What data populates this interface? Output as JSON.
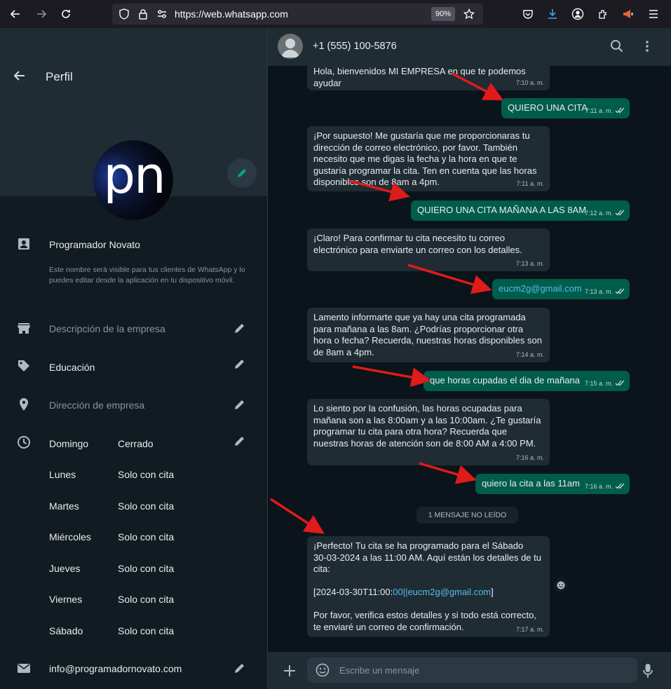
{
  "browser": {
    "url": "https://web.whatsapp.com",
    "zoom": "90%"
  },
  "profile_panel": {
    "title": "Perfil",
    "avatar_text": "pn",
    "name": "Programador Novato",
    "name_note": "Este nombre será visible para tus clientes de WhatsApp y lo puedes editar desde la aplicación en tu dispositivo móvil.",
    "description_placeholder": "Descripción de la empresa",
    "category": "Educación",
    "address_placeholder": "Dirección de empresa",
    "schedule": [
      {
        "day": "Domingo",
        "hours": "Cerrado"
      },
      {
        "day": "Lunes",
        "hours": "Solo con cita"
      },
      {
        "day": "Martes",
        "hours": "Solo con cita"
      },
      {
        "day": "Miércoles",
        "hours": "Solo con cita"
      },
      {
        "day": "Jueves",
        "hours": "Solo con cita"
      },
      {
        "day": "Viernes",
        "hours": "Solo con cita"
      },
      {
        "day": "Sábado",
        "hours": "Solo con cita"
      }
    ],
    "email": "info@programadornovato.com"
  },
  "chat": {
    "contact": "+1 (555) 100-5876",
    "messages": [
      {
        "dir": "in",
        "text": "Hola, bienvenidos MI EMPRESA en que te podemos\nayudar",
        "time": "7:10 a. m."
      },
      {
        "dir": "out",
        "text": "QUIERO UNA CITA",
        "time": "7:11 a. m."
      },
      {
        "dir": "in",
        "text": "¡Por supuesto! Me gustaría que me proporcionaras tu\ndirección de correo electrónico, por favor. También\nnecesito que me digas la fecha y la hora en que te\ngustaría programar la cita. Ten en cuenta que las horas\ndisponibles son de 8am a 4pm.",
        "time": "7:11 a. m."
      },
      {
        "dir": "out",
        "text": "QUIERO UNA CITA MAÑANA A LAS 8AM",
        "time": "7:12 a. m."
      },
      {
        "dir": "in",
        "text": "¡Claro! Para confirmar tu cita necesito tu correo\nelectrónico para enviarte un correo con los detalles.",
        "time": "7:13 a. m."
      },
      {
        "dir": "out",
        "text": "eucm2g@gmail.com",
        "time": "7:13 a. m."
      },
      {
        "dir": "in",
        "text": "Lamento informarte que ya hay una cita programada\npara mañana a las 8am. ¿Podrías proporcionar otra\nhora o fecha? Recuerda, nuestras horas disponibles son\nde 8am a 4pm.",
        "time": "7:14 a. m."
      },
      {
        "dir": "out",
        "text": "que horas cupadas el dia de mañana",
        "time": "7:15 a. m."
      },
      {
        "dir": "in",
        "text": "Lo siento por la confusión, las horas ocupadas para\nmañana son a las 8:00am y a las 10:00am. ¿Te gustaría\nprogramar tu cita para otra hora? Recuerda que\nnuestras horas de atención son de 8:00 AM a 4:00 PM.",
        "time": "7:16 a. m."
      },
      {
        "dir": "out",
        "text": "quiero la cita a las 11am",
        "time": "7:16 a. m."
      }
    ],
    "unread_divider": "1 MENSAJE NO LEÍDO",
    "last_message": {
      "line1": "¡Perfecto! Tu cita se ha programado para el Sábado\n30-03-2024 a las 11:00 AM. Aquí están los detalles de tu\ncita:",
      "details_prefix": "[2024-03-30T11:00:",
      "details_link": "00||eucm2g@gmail.com",
      "details_suffix": "]",
      "line3": "Por favor, verifica estos detalles y si todo está correcto,\nte enviaré un correo de confirmación.",
      "time": "7:17 a. m."
    },
    "input_placeholder": "Escribe un mensaje"
  },
  "colors": {
    "incoming": "#202c33",
    "outgoing": "#005c4b",
    "background": "#0b141a",
    "arrows": "#e01b1b"
  }
}
